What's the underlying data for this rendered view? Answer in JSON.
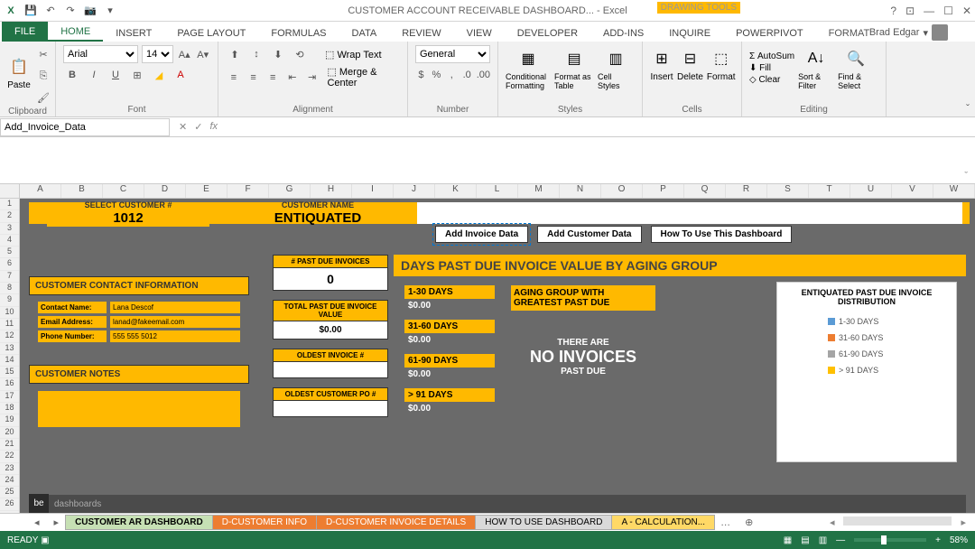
{
  "app": {
    "title": "CUSTOMER ACCOUNT RECEIVABLE DASHBOARD... - Excel",
    "user": "Brad Edgar",
    "drawing_tools": "DRAWING TOOLS"
  },
  "tabs": {
    "file": "FILE",
    "home": "HOME",
    "insert": "INSERT",
    "page_layout": "PAGE LAYOUT",
    "formulas": "FORMULAS",
    "data": "DATA",
    "review": "REVIEW",
    "view": "VIEW",
    "developer": "DEVELOPER",
    "addins": "ADD-INS",
    "inquire": "INQUIRE",
    "powerpivot": "POWERPIVOT",
    "format": "FORMAT"
  },
  "ribbon": {
    "clipboard": "Clipboard",
    "paste": "Paste",
    "font_group": "Font",
    "font_name": "Arial",
    "font_size": "14",
    "alignment": "Alignment",
    "wrap_text": "Wrap Text",
    "merge_center": "Merge & Center",
    "number": "Number",
    "num_format": "General",
    "styles": "Styles",
    "cond_fmt": "Conditional Formatting",
    "fmt_table": "Format as Table",
    "cell_styles": "Cell Styles",
    "cells": "Cells",
    "insert": "Insert",
    "delete": "Delete",
    "format": "Format",
    "editing": "Editing",
    "autosum": "AutoSum",
    "fill": "Fill",
    "clear": "Clear",
    "sort_filter": "Sort & Filter",
    "find_select": "Find & Select"
  },
  "namebox": "Add_Invoice_Data",
  "cols": [
    "A",
    "B",
    "C",
    "D",
    "E",
    "F",
    "G",
    "H",
    "I",
    "J",
    "K",
    "L",
    "M",
    "N",
    "O",
    "P",
    "Q",
    "R",
    "S",
    "T",
    "U",
    "V",
    "W"
  ],
  "rows": [
    "1",
    "2",
    "3",
    "4",
    "5",
    "6",
    "7",
    "8",
    "9",
    "10",
    "11",
    "12",
    "13",
    "14",
    "15",
    "16",
    "17",
    "18",
    "19",
    "20",
    "21",
    "22",
    "23",
    "24",
    "25",
    "26"
  ],
  "dashboard": {
    "select_customer_label": "SELECT CUSTOMER #",
    "select_customer_value": "1012",
    "customer_name_label": "CUSTOMER NAME",
    "customer_name_value": "ENTIQUATED",
    "buttons": {
      "add_invoice": "Add Invoice Data",
      "add_customer": "Add Customer Data",
      "howto": "How To Use This Dashboard"
    },
    "contact_header": "CUSTOMER CONTACT INFORMATION",
    "contact": {
      "name_lab": "Contact Name:",
      "name_val": "Lana Descof",
      "email_lab": "Email Address:",
      "email_val": "lanad@fakeemail.com",
      "phone_lab": "Phone Number:",
      "phone_val": "555 555 5012"
    },
    "notes_header": "CUSTOMER NOTES",
    "metrics": {
      "past_due_count_lab": "# PAST DUE INVOICES",
      "past_due_count_val": "0",
      "total_past_due_lab": "TOTAL PAST DUE INVOICE VALUE",
      "total_past_due_val": "$0.00",
      "oldest_inv_lab": "OLDEST INVOICE #",
      "oldest_inv_val": "",
      "oldest_po_lab": "OLDEST CUSTOMER PO #",
      "oldest_po_val": ""
    },
    "aging_title": "DAYS PAST DUE INVOICE VALUE BY AGING GROUP",
    "aging": {
      "g1_lab": "1-30 DAYS",
      "g1_val": "$0.00",
      "g2_lab": "31-60 DAYS",
      "g2_val": "$0.00",
      "g3_lab": "61-90 DAYS",
      "g3_val": "$0.00",
      "g4_lab": "> 91 DAYS",
      "g4_val": "$0.00"
    },
    "greatest": {
      "hdr": "AGING GROUP WITH GREATEST PAST DUE",
      "l1": "THERE ARE",
      "l2": "NO INVOICES",
      "l3": "PAST DUE"
    },
    "chart": {
      "title": "ENTIQUATED PAST DUE INVOICE DISTRIBUTION",
      "legend": [
        "1-30 DAYS",
        "31-60 DAYS",
        "61-90 DAYS",
        "> 91 DAYS"
      ],
      "colors": [
        "#5b9bd5",
        "#ed7d31",
        "#a5a5a5",
        "#ffc000"
      ]
    },
    "footer": "dashboards"
  },
  "chart_data": {
    "type": "pie",
    "title": "ENTIQUATED PAST DUE INVOICE DISTRIBUTION",
    "categories": [
      "1-30 DAYS",
      "31-60 DAYS",
      "61-90 DAYS",
      "> 91 DAYS"
    ],
    "values": [
      0,
      0,
      0,
      0
    ]
  },
  "sheets": {
    "s1": "CUSTOMER AR DASHBOARD",
    "s2": "D-CUSTOMER INFO",
    "s3": "D-CUSTOMER INVOICE DETAILS",
    "s4": "HOW TO USE DASHBOARD",
    "s5": "A - CALCULATION..."
  },
  "status": {
    "ready": "READY",
    "zoom": "58%"
  }
}
